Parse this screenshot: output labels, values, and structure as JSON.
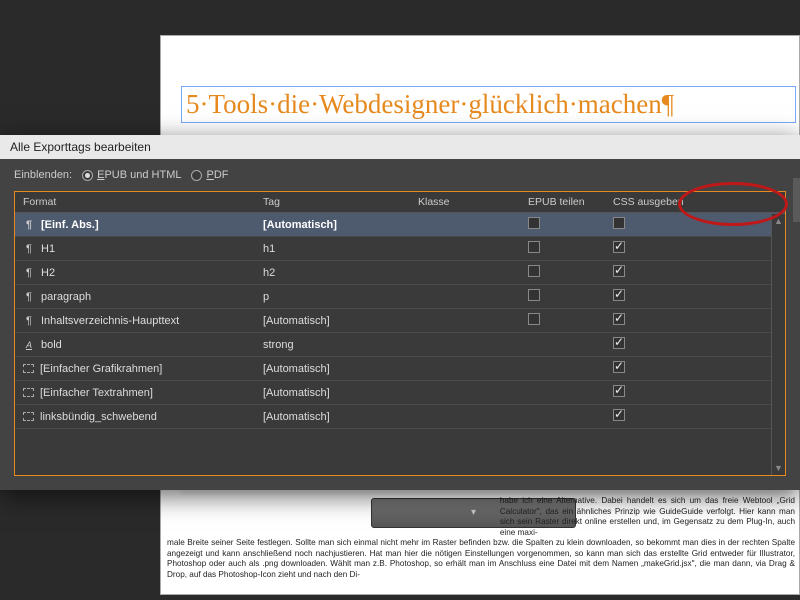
{
  "page": {
    "headline": "5·Tools·die·Webdesigner·glücklich·machen¶",
    "bottom_right": "habe ich eine Alternative. Dabei handelt es sich um das freie Webtool „Grid Calculator\", das ein ähnliches Prinzip wie GuideGuide verfolgt.\nHier kann man sich sein Raster direkt online erstellen und, im Gegensatz zu dem Plug-In, auch eine maxi-",
    "bottom_full": "male Breite seiner Seite festlegen. Sollte man sich einmal nicht mehr im Raster befinden bzw. die Spalten zu klein downloaden, so bekommt man dies in der rechten Spalte angezeigt und kann anschließend noch nachjustieren. Hat man hier die nötigen Einstellungen vorgenommen, so kann man sich das erstellte Grid entweder für Illustrator, Photoshop oder auch als .png downloaden. Wählt man z.B. Photoshop, so erhält man im Anschluss eine Datei mit dem Namen „makeGrid.jsx\", die man dann, via Drag & Drop, auf das Photoshop-Icon zieht und nach den Di-"
  },
  "dialog": {
    "title": "Alle Exporttags bearbeiten",
    "filter_label": "Einblenden:",
    "radio1_hot": "E",
    "radio1_rest": "PUB und HTML",
    "radio2_hot": "P",
    "radio2_rest": "DF",
    "columns": {
      "format": "Format",
      "tag": "Tag",
      "klasse": "Klasse",
      "epub": "EPUB teilen",
      "css": "CSS ausgeben"
    },
    "rows": [
      {
        "icon": "para",
        "format": "[Einf. Abs.]",
        "tag": "[Automatisch]",
        "klasse": "",
        "epub": false,
        "css": false,
        "selected": true
      },
      {
        "icon": "para",
        "format": "H1",
        "tag": "h1",
        "klasse": "",
        "epub": false,
        "css": true
      },
      {
        "icon": "para",
        "format": "H2",
        "tag": "h2",
        "klasse": "",
        "epub": false,
        "css": true
      },
      {
        "icon": "para",
        "format": "paragraph",
        "tag": "p",
        "klasse": "",
        "epub": false,
        "css": true
      },
      {
        "icon": "para",
        "format": "Inhaltsverzeichnis-Haupttext",
        "tag": "[Automatisch]",
        "klasse": "",
        "epub": false,
        "css": true
      },
      {
        "icon": "char",
        "format": "bold",
        "tag": "strong",
        "klasse": "",
        "epub": null,
        "css": true
      },
      {
        "icon": "frame",
        "format": "[Einfacher Grafikrahmen]",
        "tag": "[Automatisch]",
        "klasse": "",
        "epub": null,
        "css": true
      },
      {
        "icon": "frame",
        "format": "[Einfacher Textrahmen]",
        "tag": "[Automatisch]",
        "klasse": "",
        "epub": null,
        "css": true
      },
      {
        "icon": "frame",
        "format": "linksbündig_schwebend",
        "tag": "[Automatisch]",
        "klasse": "",
        "epub": null,
        "css": true
      }
    ]
  }
}
